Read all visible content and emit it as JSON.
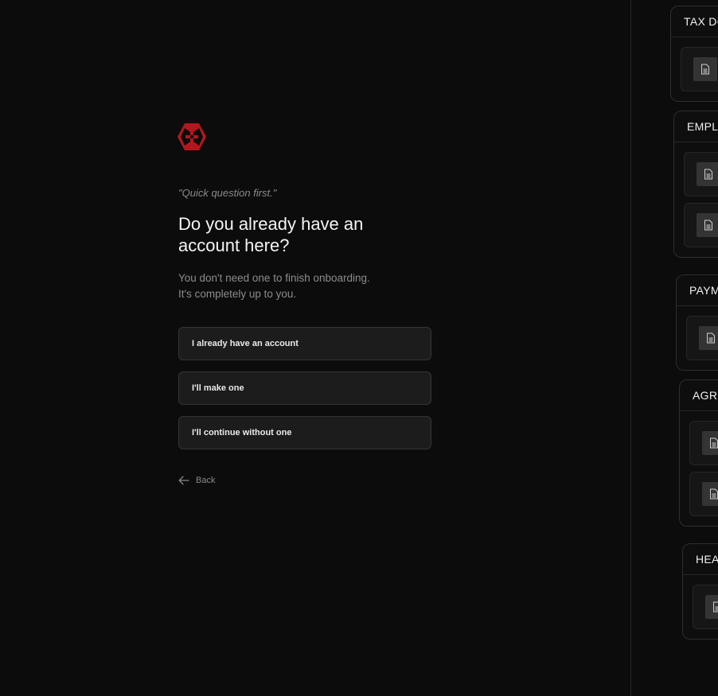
{
  "onboarding": {
    "quote": "\"Quick question first.\"",
    "title": "Do you already have an account here?",
    "subtitle_line1": "You don't need one to finish onboarding.",
    "subtitle_line2": "It's completely up to you.",
    "options": [
      {
        "label": "I already have an account"
      },
      {
        "label": "I'll make one"
      },
      {
        "label": "I'll continue without one"
      }
    ],
    "back_label": "Back"
  },
  "documents_panel": {
    "groups": [
      {
        "title": "TAX DC",
        "doc_icons": [
          "document-icon"
        ]
      },
      {
        "title": "EMPLO",
        "doc_icons": [
          "document-icon",
          "document-icon"
        ]
      },
      {
        "title": "PAYM",
        "doc_icons": [
          "document-icon"
        ]
      },
      {
        "title": "AGRE",
        "doc_icons": [
          "document-icon",
          "document-icon"
        ]
      },
      {
        "title": "HEA",
        "doc_icons": [
          "document-icon"
        ]
      }
    ]
  },
  "colors": {
    "background": "#0c0c0c",
    "logo_red": "#b3171d",
    "button_bg": "#1c1c1c"
  }
}
